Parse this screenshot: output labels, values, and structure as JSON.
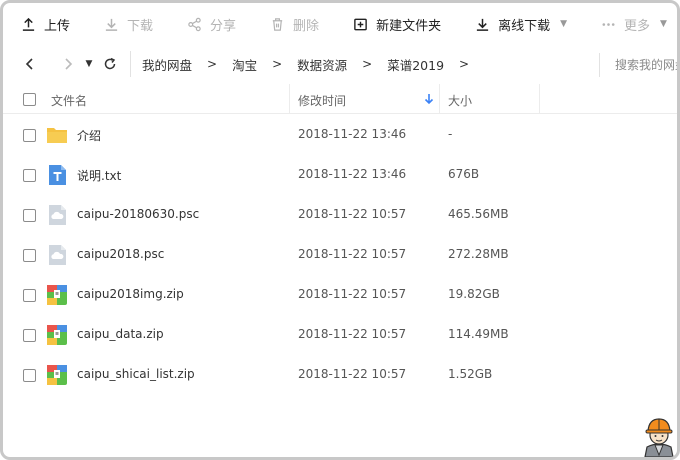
{
  "toolbar": {
    "upload": "上传",
    "download": "下载",
    "share": "分享",
    "delete": "删除",
    "new_folder": "新建文件夹",
    "offline_download": "离线下载",
    "more": "更多"
  },
  "breadcrumb": {
    "items": [
      "我的网盘",
      "淘宝",
      "数据资源",
      "菜谱2019"
    ],
    "separator": ">"
  },
  "search": {
    "placeholder": "搜索我的网盘"
  },
  "table": {
    "columns": {
      "name": "文件名",
      "modified": "修改时间",
      "size": "大小"
    },
    "sort": {
      "column": "modified",
      "direction": "descending"
    },
    "rows": [
      {
        "name": "介绍",
        "modified": "2018-11-22 13:46",
        "size": "-",
        "icon": "folder-icon"
      },
      {
        "name": "说明.txt",
        "modified": "2018-11-22 13:46",
        "size": "676B",
        "icon": "txt-file-icon"
      },
      {
        "name": "caipu-20180630.psc",
        "modified": "2018-11-22 10:57",
        "size": "465.56MB",
        "icon": "cloud-file-icon"
      },
      {
        "name": "caipu2018.psc",
        "modified": "2018-11-22 10:57",
        "size": "272.28MB",
        "icon": "cloud-file-icon"
      },
      {
        "name": "caipu2018img.zip",
        "modified": "2018-11-22 10:57",
        "size": "19.82GB",
        "icon": "zip-file-icon"
      },
      {
        "name": "caipu_data.zip",
        "modified": "2018-11-22 10:57",
        "size": "114.49MB",
        "icon": "zip-file-icon"
      },
      {
        "name": "caipu_shicai_list.zip",
        "modified": "2018-11-22 10:57",
        "size": "1.52GB",
        "icon": "zip-file-icon"
      }
    ]
  },
  "colors": {
    "folder": "#f5c242",
    "txt": "#4a90e2",
    "cloud_file": "#cfd6de",
    "sort_arrow": "#3b82f6",
    "disabled_text": "#b4b4b4"
  }
}
